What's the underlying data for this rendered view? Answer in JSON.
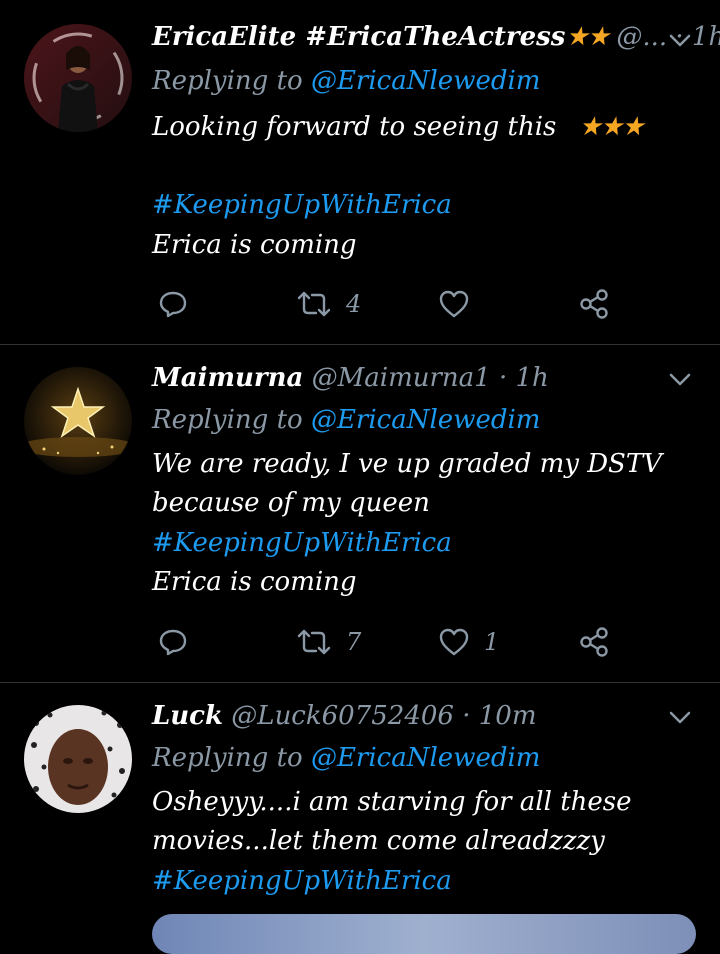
{
  "tweets": [
    {
      "name": "EricaElite #EricaTheActress",
      "name_stars": "★★",
      "handle": "@...",
      "time": "· 1h",
      "replying_label": "Replying to",
      "replying_to": "@EricaNlewedim",
      "lines": [
        "Looking forward to seeing this"
      ],
      "line_stars": "★★★",
      "hashtag": "#KeepingUpWithErica",
      "after": "Erica is coming",
      "retweets": "4",
      "likes": ""
    },
    {
      "name": "Maimurna",
      "handle": "@Maimurna1",
      "time": "· 1h",
      "replying_label": "Replying to",
      "replying_to": "@EricaNlewedim",
      "lines": [
        "We are ready,  I ve up graded my DSTV",
        "because of my queen"
      ],
      "hashtag": "#KeepingUpWithErica",
      "after": "Erica is coming",
      "retweets": "7",
      "likes": "1"
    },
    {
      "name": "Luck",
      "handle": "@Luck60752406",
      "time": "· 10m",
      "replying_label": "Replying to",
      "replying_to": "@EricaNlewedim",
      "lines": [
        "Osheyyy....i am starving for all these",
        "movies...let them come alreadzzzy"
      ],
      "hashtag": "#KeepingUpWithErica"
    }
  ],
  "icons": {
    "reply": "reply-icon",
    "retweet": "retweet-icon",
    "like": "heart-icon",
    "share": "share-icon",
    "more": "chevron-down-icon"
  },
  "colors": {
    "background": "#000000",
    "link": "#1d9bf0",
    "muted": "#8b98a5",
    "star": "#f5a623"
  }
}
